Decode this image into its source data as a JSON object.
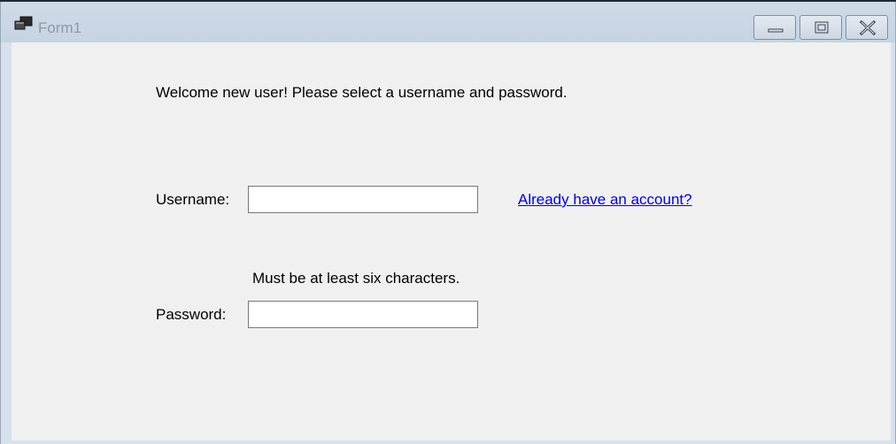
{
  "window": {
    "title": "Form1",
    "icon": "app-window-icon",
    "controls": {
      "minimize": "minimize-icon",
      "maximize": "maximize-icon",
      "close": "close-icon"
    }
  },
  "form": {
    "welcome_text": "Welcome new user! Please select a username and password.",
    "username_label": "Username:",
    "username_value": "",
    "login_link": "Already have an account?",
    "password_hint": "Must be at least six characters.",
    "password_label": "Password:",
    "password_value": ""
  },
  "colors": {
    "client_background": "#f0f0f0",
    "titlebar": "#cfdbe7",
    "link": "#0000ee"
  }
}
